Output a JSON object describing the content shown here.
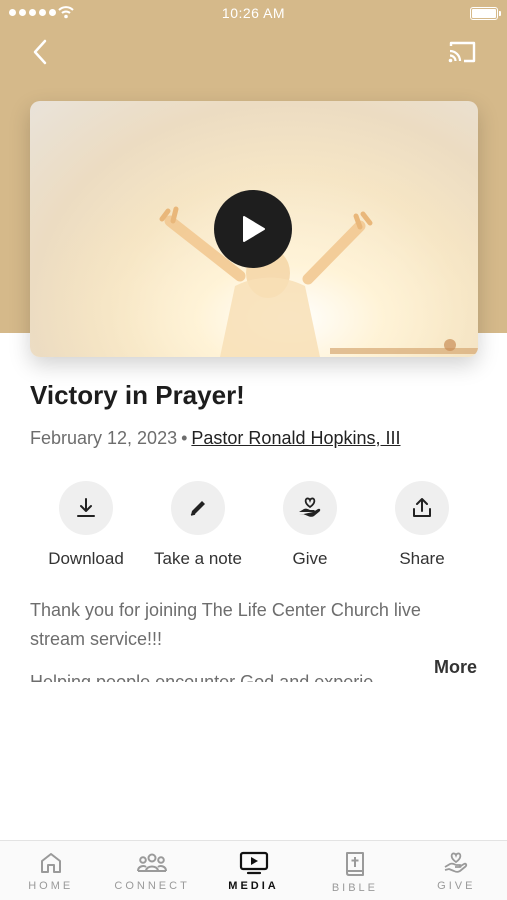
{
  "status_bar": {
    "time": "10:26 AM"
  },
  "nav": {
    "back_icon": "chevron-left-icon",
    "cast_icon": "cast-icon"
  },
  "video": {
    "play_icon": "play-icon"
  },
  "sermon": {
    "title": "Victory in Prayer!",
    "date": "February 12, 2023",
    "separator": "•",
    "pastor": "Pastor Ronald Hopkins, III"
  },
  "actions": [
    {
      "label": "Download",
      "icon": "download-icon"
    },
    {
      "label": "Take a note",
      "icon": "pencil-icon"
    },
    {
      "label": "Give",
      "icon": "give-heart-hand-icon"
    },
    {
      "label": "Share",
      "icon": "share-icon"
    }
  ],
  "description": {
    "line1": "Thank you for joining The Life Center Church live stream service!!!",
    "line2": "Helping people encounter God and experie...",
    "more_label": "More"
  },
  "tabs": [
    {
      "label": "HOME",
      "icon": "home-icon",
      "active": false
    },
    {
      "label": "CONNECT",
      "icon": "people-icon",
      "active": false
    },
    {
      "label": "MEDIA",
      "icon": "tv-play-icon",
      "active": true
    },
    {
      "label": "BIBLE",
      "icon": "bible-icon",
      "active": false
    },
    {
      "label": "GIVE",
      "icon": "give-heart-hand-icon",
      "active": false
    }
  ],
  "colors": {
    "header": "#d5b98a",
    "accent": "#111111",
    "muted": "#6d6d6d"
  }
}
